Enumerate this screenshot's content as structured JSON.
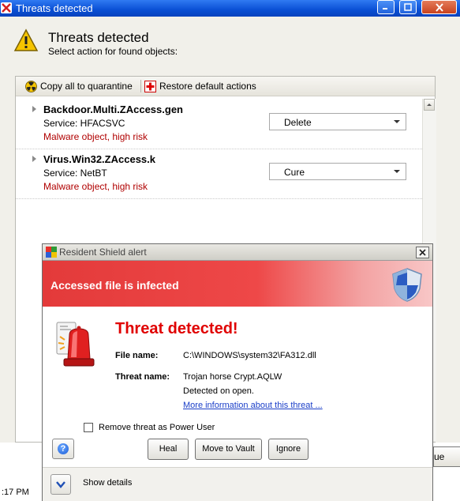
{
  "main_window": {
    "title": "Threats detected",
    "heading": "Threats detected",
    "subheading": "Select action for found objects:",
    "toolbar": {
      "quarantine_label": "Copy all to quarantine",
      "restore_label": "Restore default actions"
    },
    "threats": [
      {
        "name": "Backdoor.Multi.ZAccess.gen",
        "service": "Service: HFACSVC",
        "risk": "Malware object, high risk",
        "action": "Delete"
      },
      {
        "name": "Virus.Win32.ZAccess.k",
        "service": "Service: NetBT",
        "risk": "Malware object, high risk",
        "action": "Cure"
      }
    ],
    "partial_button": "ue"
  },
  "taskbar": {
    "clock": ":17 PM"
  },
  "alert": {
    "title": "Resident Shield alert",
    "banner": "Accessed file is infected",
    "headline": "Threat detected!",
    "file_name_label": "File name:",
    "file_name_value": "C:\\WINDOWS\\system32\\FA312.dll",
    "threat_name_label": "Threat name:",
    "threat_name_value": "Trojan horse Crypt.AQLW",
    "detected_text": "Detected on open.",
    "more_info_link": "More information about this threat ...",
    "power_user_checkbox": "Remove threat as Power User",
    "power_user_checked": false,
    "buttons": {
      "heal": "Heal",
      "vault": "Move to Vault",
      "ignore": "Ignore"
    },
    "show_details": "Show details"
  },
  "colors": {
    "titlebar_blue": "#0a4fd4",
    "alert_red": "#e33a3a",
    "risk_text": "#b00000",
    "headline_red": "#e00000",
    "link_blue": "#1a3ec8"
  }
}
